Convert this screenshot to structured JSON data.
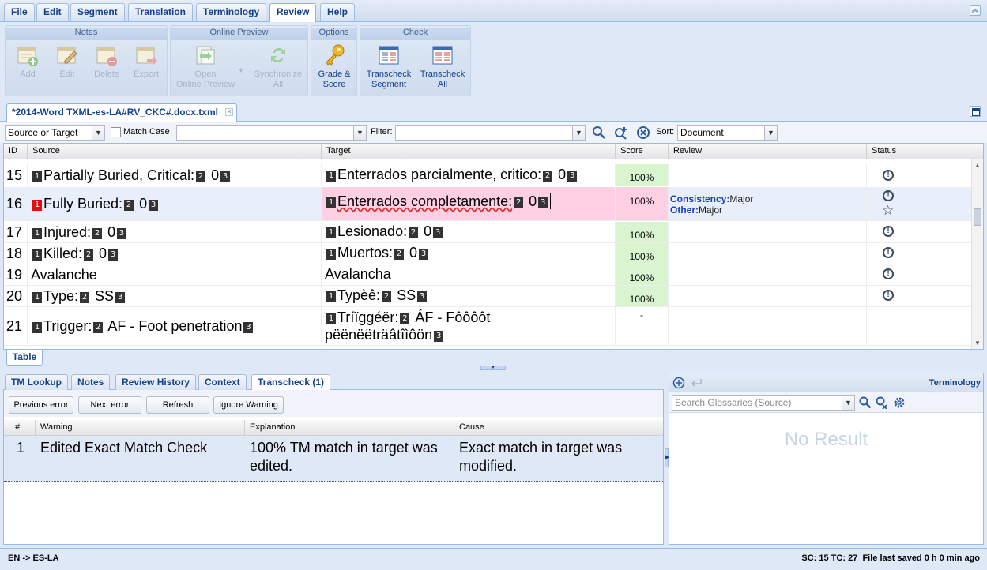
{
  "menu": {
    "tabs": [
      "File",
      "Edit",
      "Segment",
      "Translation",
      "Terminology",
      "Review",
      "Help"
    ],
    "active": "Review"
  },
  "ribbon": {
    "notes": {
      "title": "Notes",
      "add": "Add",
      "edit": "Edit",
      "delete": "Delete",
      "export": "Export"
    },
    "online_preview": {
      "title": "Online Preview",
      "open_l1": "Open",
      "open_l2": "Online Preview",
      "sync_l1": "Synchronize",
      "sync_l2": "All"
    },
    "options": {
      "title": "Options",
      "grade_l1": "Grade &",
      "grade_l2": "Score"
    },
    "check": {
      "title": "Check",
      "seg_l1": "Transcheck",
      "seg_l2": "Segment",
      "all_l1": "Transcheck",
      "all_l2": "All"
    }
  },
  "document": {
    "tab_title": "*2014-Word TXML-es-LA#RV_CKC#.docx.txml"
  },
  "filter": {
    "scope_value": "Source or Target",
    "match_case_label": "Match Case",
    "search_value": "",
    "filter_label": "Filter:",
    "filter_value": "",
    "sort_label": "Sort:",
    "sort_value": "Document"
  },
  "grid": {
    "headers": {
      "id": "ID",
      "source": "Source",
      "target": "Target",
      "score": "Score",
      "review": "Review",
      "status": "Status"
    },
    "rows": [
      {
        "id": "15",
        "src_pre": "Partially Buried, Critical:",
        "src_num": "0",
        "tgt_pre": "Enterrados parcialmente, critico:",
        "tgt_num": "0",
        "score": "100%"
      },
      {
        "id": "16",
        "src_pre": "Fully Buried:",
        "src_num": "0",
        "tgt_pre": "Enterrados completamente:",
        "tgt_num": "0",
        "score": "100%",
        "review1_k": "Consistency:",
        "review1_v": "Major",
        "review2_k": "Other:",
        "review2_v": "Major"
      },
      {
        "id": "17",
        "src_pre": "Injured:",
        "src_num": "0",
        "tgt_pre": "Lesionado:",
        "tgt_num": "0",
        "score": "100%"
      },
      {
        "id": "18",
        "src_pre": "Killed:",
        "src_num": "0",
        "tgt_pre": "Muertos:",
        "tgt_num": "0",
        "score": "100%"
      },
      {
        "id": "19",
        "src_pre": "Avalanche",
        "tgt_pre": "Avalancha",
        "score": "100%"
      },
      {
        "id": "20",
        "src_pre": "Type:",
        "src_num": "SS",
        "tgt_pre": "Typèê:",
        "tgt_num": "SS",
        "score": "100%"
      },
      {
        "id": "21",
        "src_pre": "Trigger:",
        "src_num": "AF - Foot penetration",
        "tgt_pre": "Tríïggéër:",
        "tgt_num": "ÁF - Fôôôôt",
        "tgt_line2": "pëënëëträâtîìôön",
        "score": "-"
      }
    ],
    "tag1": "1",
    "tag2": "2",
    "tag3": "3"
  },
  "table_tab": "Table",
  "bottom": {
    "tabs": [
      "TM Lookup",
      "Notes",
      "Review History",
      "Context",
      "Transcheck (1)"
    ],
    "active": "Transcheck (1)",
    "toolbar": {
      "prev": "Previous error",
      "next": "Next error",
      "refresh": "Refresh",
      "ignore": "Ignore Warning"
    },
    "headers": {
      "num": "#",
      "warning": "Warning",
      "explanation": "Explanation",
      "cause": "Cause"
    },
    "rows": [
      {
        "num": "1",
        "warning": "Edited Exact Match Check",
        "explanation": "100% TM match in target was edited.",
        "cause": "Exact match in target was modified."
      }
    ]
  },
  "terminology": {
    "title": "Terminology",
    "search_placeholder": "Search Glossaries (Source)",
    "no_result": "No Result"
  },
  "status": {
    "lang": "EN -> ES-LA",
    "right": "SC: 15 TC: 27  File last saved 0 h 0 min ago"
  }
}
